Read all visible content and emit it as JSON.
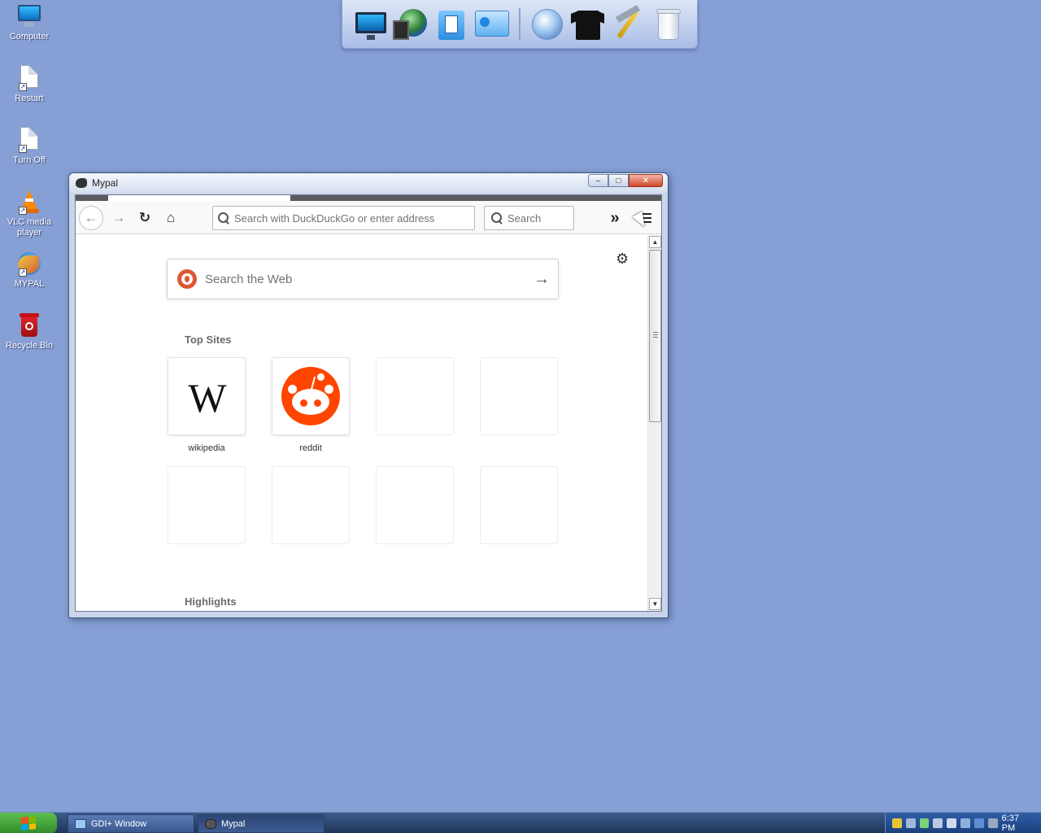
{
  "desktop": {
    "icons": [
      {
        "label": "Computer"
      },
      {
        "label": "Restart"
      },
      {
        "label": "Turn Off"
      },
      {
        "label": "VLC media player"
      },
      {
        "label": "MYPAL"
      },
      {
        "label": "Recycle Bin"
      }
    ]
  },
  "dock": {
    "items": [
      "monitor-icon",
      "globe-icon",
      "document-icon",
      "control-panel-icon",
      "network-globe-icon",
      "tshirt-icon",
      "tools-icon",
      "recycle-bin-icon"
    ]
  },
  "window": {
    "title": "Mypal",
    "buttons": {
      "minimize": "–",
      "maximize": "□",
      "close": "✕"
    }
  },
  "toolbar": {
    "back": "←",
    "forward": "→",
    "reload": "↻",
    "home": "⌂",
    "url_placeholder": "Search with DuckDuckGo or enter address",
    "search_placeholder": "Search",
    "overflow": "»"
  },
  "newtab": {
    "settings_icon": "⚙",
    "web_search_placeholder": "Search the Web",
    "go_arrow": "→",
    "top_sites_title": "Top Sites",
    "top_sites": [
      {
        "label": "wikipedia",
        "glyph": "W"
      },
      {
        "label": "reddit"
      }
    ],
    "highlights_title": "Highlights"
  },
  "taskbar": {
    "tasks": [
      {
        "label": "GDI+ Window"
      },
      {
        "label": "Mypal"
      }
    ],
    "clock": "6:37 PM"
  }
}
